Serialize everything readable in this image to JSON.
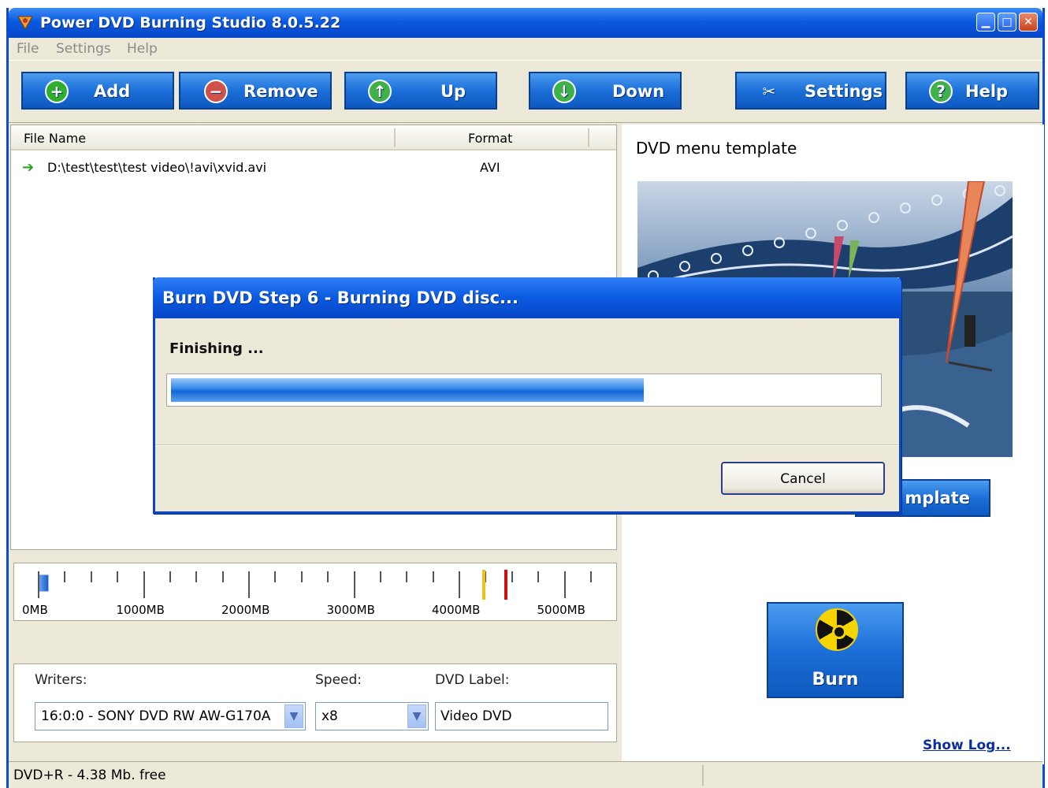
{
  "window": {
    "title": "Power DVD Burning Studio 8.0.5.22"
  },
  "menu": {
    "file": "File",
    "settings": "Settings",
    "help": "Help"
  },
  "toolbar": {
    "add": "Add",
    "remove": "Remove",
    "up": "Up",
    "down": "Down",
    "settings": "Settings",
    "help": "Help"
  },
  "file_list": {
    "columns": [
      "File Name",
      "Format"
    ],
    "rows": [
      {
        "name": "D:\\test\\test\\test video\\!avi\\xvid.avi",
        "format": "AVI"
      }
    ]
  },
  "dvd_menu": {
    "title": "DVD menu template",
    "template_button_visible": "mplate"
  },
  "size_scale": {
    "labels": [
      "0MB",
      "1000MB",
      "2000MB",
      "3000MB",
      "4000MB",
      "5000MB"
    ],
    "used_fraction": 0.008
  },
  "writer": {
    "writers_label": "Writers:",
    "writer_value": "16:0:0 - SONY DVD RW AW-G170A",
    "speed_label": "Speed:",
    "speed_value": "x8",
    "dvd_label_label": "DVD Label:",
    "dvd_label_value": "Video DVD"
  },
  "burn": {
    "label": "Burn"
  },
  "show_log": "Show Log...",
  "status": {
    "text": "DVD+R - 4.38 Mb. free"
  },
  "dialog": {
    "title": "Burn DVD Step 6 - Burning DVD disc...",
    "status": "Finishing ...",
    "progress": 0.67,
    "cancel": "Cancel"
  },
  "colors": {
    "title_blue": "#0a5ae0",
    "button_blue": "#1b6fd8",
    "progress_blue": "#2e86e8",
    "burn_yellow": "#f5d400",
    "marker_yellow": "#f0c020",
    "marker_red": "#d01010"
  }
}
